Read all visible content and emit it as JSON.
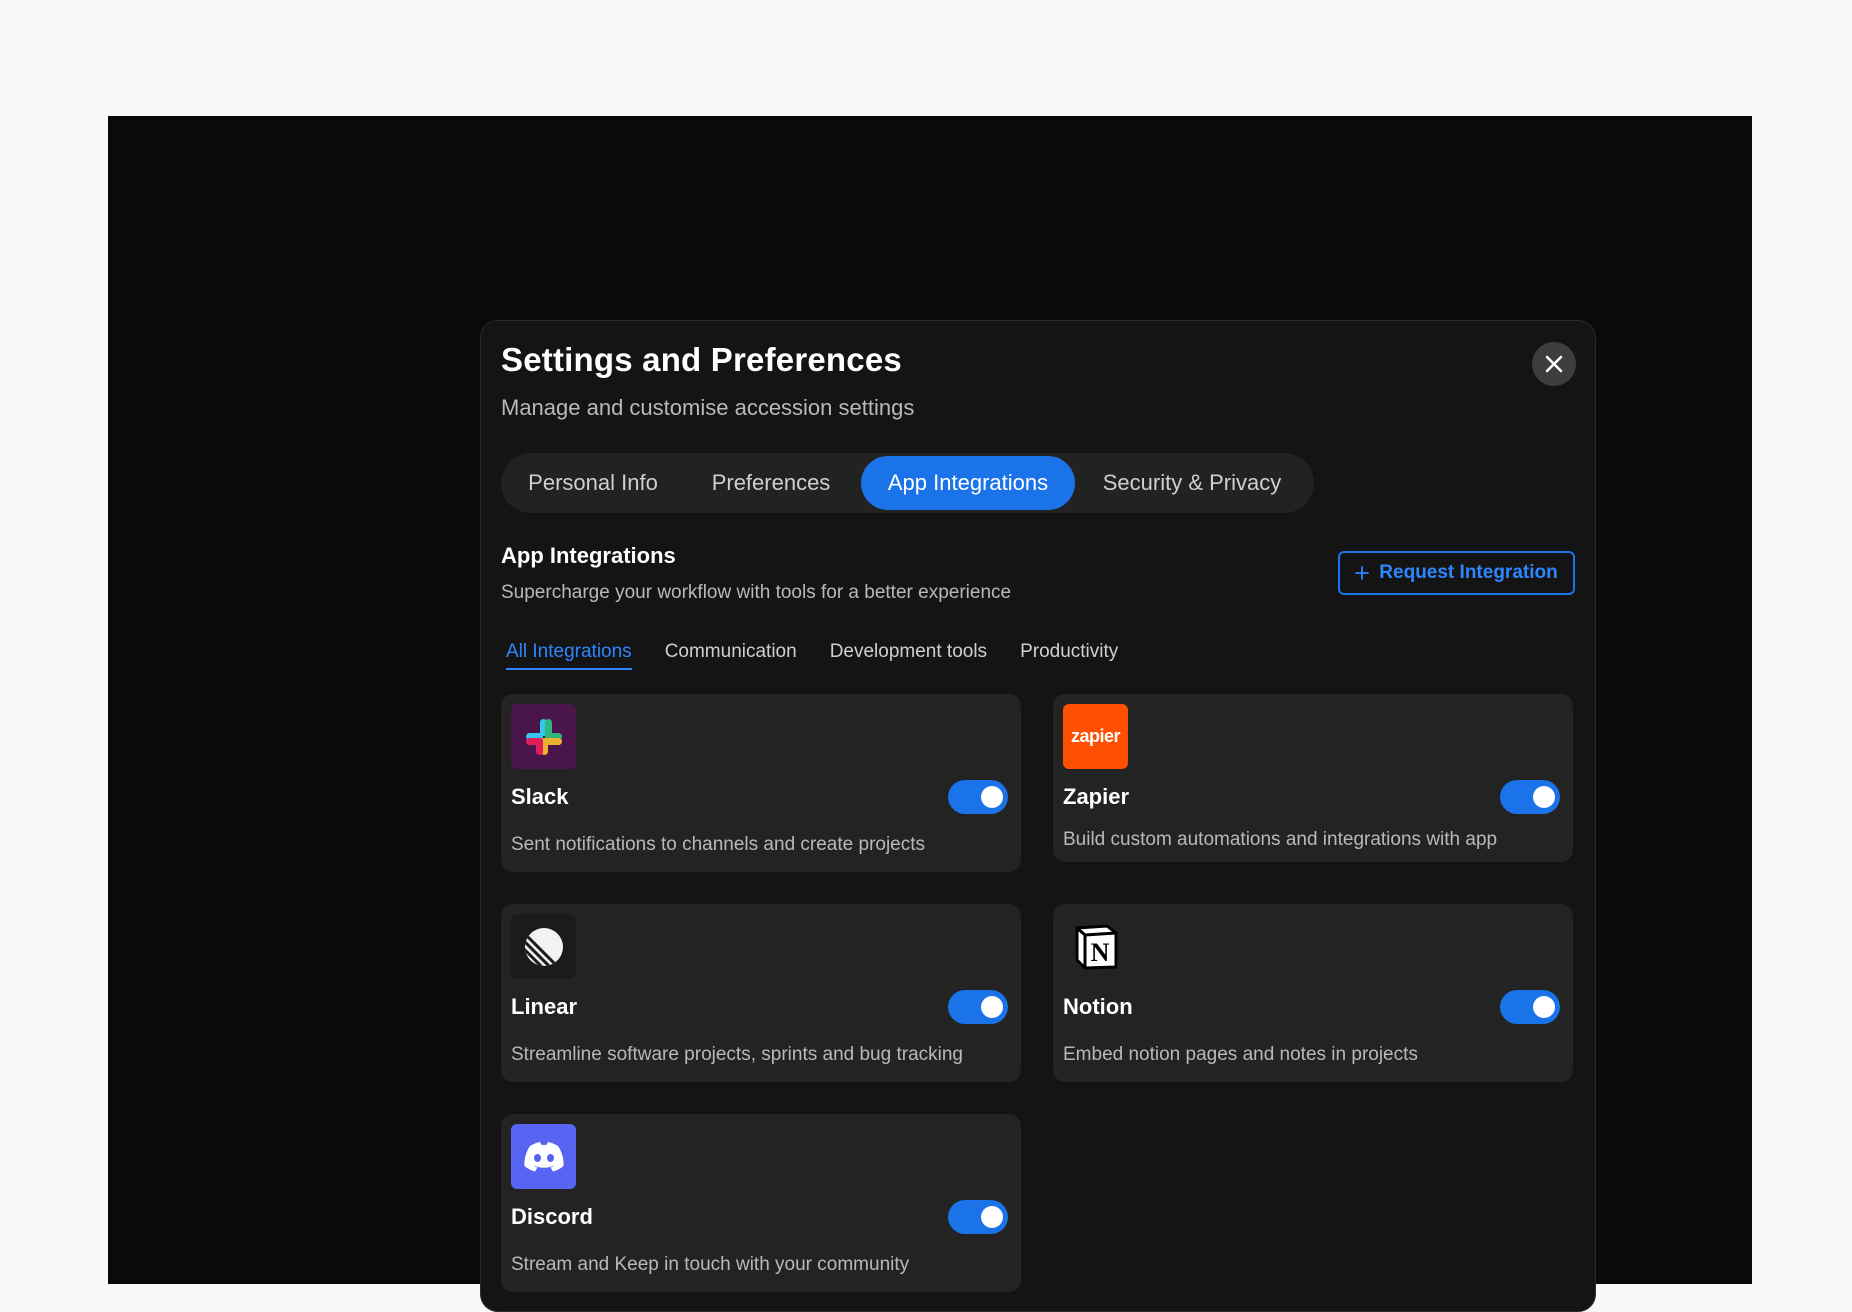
{
  "header": {
    "title": "Settings and Preferences",
    "subtitle": "Manage and customise accession settings"
  },
  "tabs": [
    {
      "label": "Personal Info",
      "active": false
    },
    {
      "label": "Preferences",
      "active": false
    },
    {
      "label": "App Integrations",
      "active": true
    },
    {
      "label": "Security & Privacy",
      "active": false
    }
  ],
  "section": {
    "title": "App Integrations",
    "subtitle": "Supercharge your workflow with tools for a better experience",
    "request_button": "Request Integration",
    "request_icon": "plus-icon"
  },
  "filters": [
    {
      "label": "All Integrations",
      "active": true
    },
    {
      "label": "Communication",
      "active": false
    },
    {
      "label": "Development tools",
      "active": false
    },
    {
      "label": "Productivity",
      "active": false
    }
  ],
  "integrations": [
    {
      "name": "Slack",
      "description": "Sent notifications to channels and create projects",
      "enabled": true,
      "icon": "slack-icon"
    },
    {
      "name": "Zapier",
      "description": "Build custom automations and integrations with app",
      "enabled": true,
      "icon": "zapier-icon",
      "icon_text": "zapier"
    },
    {
      "name": "Linear",
      "description": "Streamline software projects, sprints and bug tracking",
      "enabled": true,
      "icon": "linear-icon"
    },
    {
      "name": "Notion",
      "description": "Embed notion pages and notes in projects",
      "enabled": true,
      "icon": "notion-icon"
    },
    {
      "name": "Discord",
      "description": "Stream and Keep in touch with your community",
      "enabled": true,
      "icon": "discord-icon"
    }
  ],
  "colors": {
    "accent": "#1a73e8",
    "modal_bg": "#141414",
    "card_bg": "#232323",
    "zapier": "#ff4f00",
    "slack_bg": "#4a154b",
    "discord": "#5865f2"
  }
}
